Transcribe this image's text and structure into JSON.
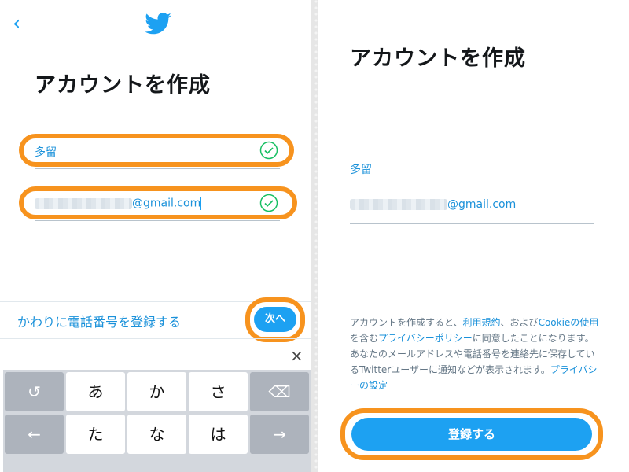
{
  "left": {
    "title": "アカウントを作成",
    "name_value": "多留",
    "email_value": "@gmail.com",
    "phone_link": "かわりに電話番号を登録する",
    "next_button": "次へ",
    "close_glyph": "×",
    "keyboard": {
      "undo": "↺",
      "row1": [
        "あ",
        "か",
        "さ"
      ],
      "delete": "⌫",
      "left_arrow": "←",
      "row2": [
        "た",
        "な",
        "は"
      ],
      "right_arrow": "→"
    }
  },
  "right": {
    "title": "アカウントを作成",
    "name_value": "多留",
    "email_value": "@gmail.com",
    "legal": {
      "p1": "アカウントを作成すると、",
      "terms": "利用規約",
      "p2": "、および",
      "cookie": "Cookieの使用",
      "p3": "を含む",
      "privacy": "プライバシーポリシー",
      "p4": "に同意したことになります。あなたのメールアドレスや電話番号を連絡先に保存しているTwitterユーザーに通知などが表示されます。",
      "privacy_settings": "プライバシーの設定"
    },
    "register_button": "登録する"
  },
  "colors": {
    "accent": "#1da1f2",
    "link": "#1a91da",
    "highlight": "#f7931e",
    "check": "#17bf63"
  }
}
